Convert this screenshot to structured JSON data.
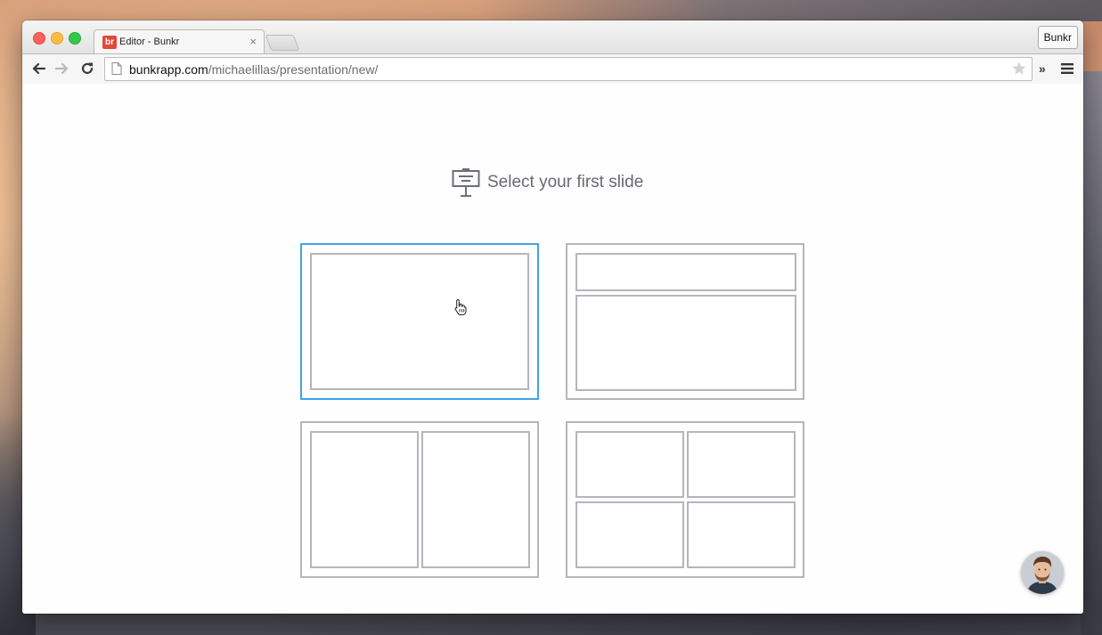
{
  "browser": {
    "tab": {
      "favicon_text": "br",
      "title": "Editor - Bunkr",
      "close_glyph": "×"
    },
    "profile_button": "Bunkr",
    "url": {
      "host": "bunkrapp.com",
      "path": "/michaelillas/presentation/new/"
    },
    "extensions_glyph": "»"
  },
  "page": {
    "heading": "Select your first slide",
    "layouts": [
      {
        "name": "blank",
        "selected": true
      },
      {
        "name": "title-and-content",
        "selected": false
      },
      {
        "name": "two-columns",
        "selected": false
      },
      {
        "name": "four-grid",
        "selected": false
      }
    ]
  },
  "colors": {
    "selected_border": "#41a3e6",
    "layout_border": "#b4b6bc",
    "heading": "#666a73",
    "favicon": "#e2483b"
  },
  "icons": {
    "heading": "presentation-board-icon",
    "nav": [
      "back-arrow-icon",
      "forward-arrow-icon",
      "reload-icon"
    ],
    "omnibox": [
      "page-icon",
      "star-icon"
    ],
    "menu": "hamburger-menu-icon"
  }
}
